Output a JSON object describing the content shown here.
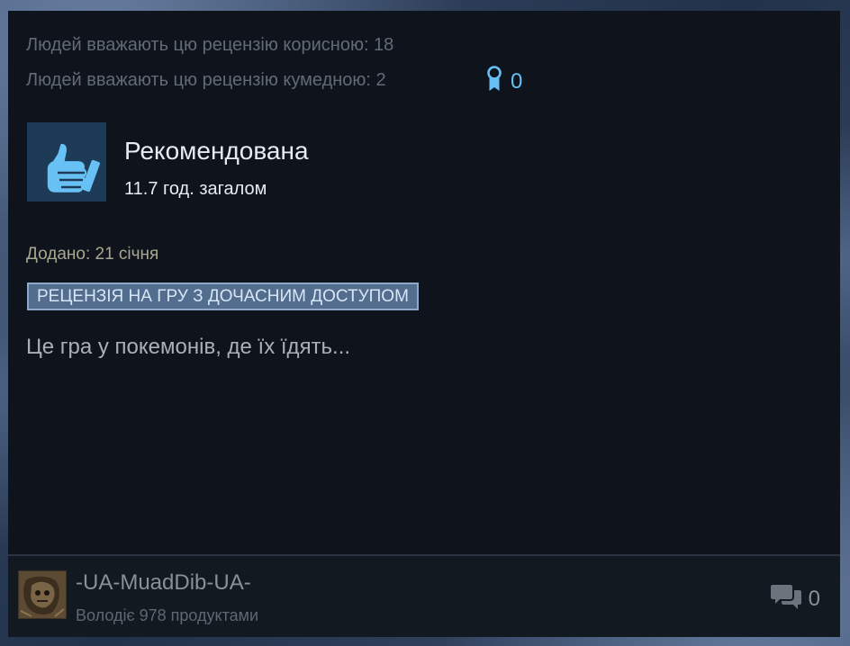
{
  "helpful": {
    "useful_text": "Людей вважають цю рецензію корисною: 18",
    "funny_text": "Людей вважають цю рецензію кумедною: 2",
    "awards_count": "0",
    "award_icon": "award-ribbon-icon",
    "accent_color": "#66c0f4"
  },
  "recommendation": {
    "label": "Рекомендована",
    "hours": "11.7 год. загалом",
    "icon": "thumbs-up-icon"
  },
  "review": {
    "posted": "Додано: 21 січня",
    "early_access_tag": "РЕЦЕНЗІЯ НА ГРУ З ДОЧАСНИМ ДОСТУПОМ",
    "text": "Це гра у покемонів, де їх їдять..."
  },
  "author": {
    "name": "-UA-MuadDib-UA-",
    "products": "Володіє 978 продуктами",
    "avatar": "avatar"
  },
  "comments": {
    "count": "0",
    "icon": "comments-icon"
  }
}
